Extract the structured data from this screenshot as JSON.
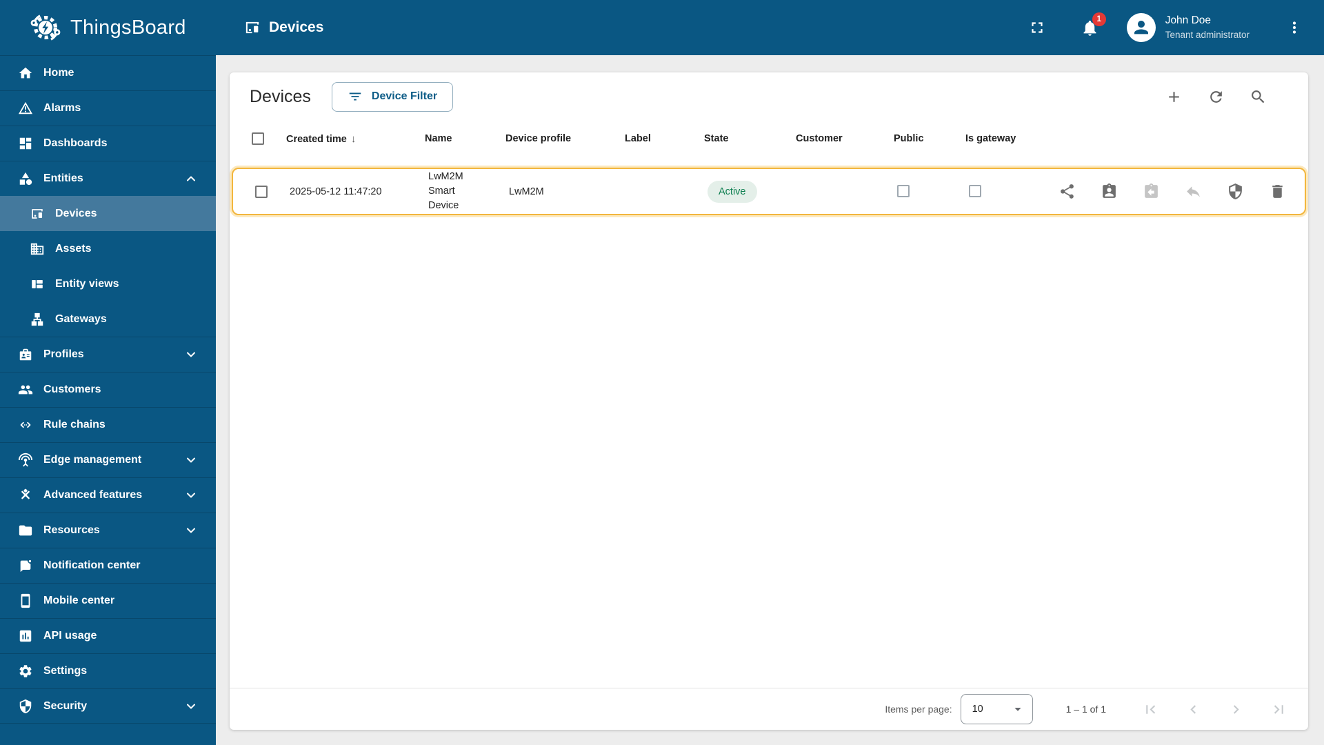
{
  "colors": {
    "primary": "#0a5783",
    "sidebar_selected": "#44799d",
    "row_highlight_border": "#f2b63d",
    "active_state_bg": "#e4efe9",
    "active_state_text": "#0c7e4f",
    "badge_red": "#e53935",
    "content_background": "#ededed"
  },
  "header": {
    "app_name": "ThingsBoard",
    "breadcrumb": "Devices",
    "notification_count": "1",
    "icons": [
      "thingsboard-logo-icon",
      "devices-breadcrumb-icon",
      "fullscreen-icon",
      "notifications-icon",
      "user-avatar-icon",
      "more-vert-icon"
    ],
    "user": {
      "name": "John Doe",
      "role": "Tenant administrator"
    }
  },
  "sidebar": {
    "items": [
      {
        "label": "Home",
        "icon": "home-icon"
      },
      {
        "label": "Alarms",
        "icon": "alarms-icon"
      },
      {
        "label": "Dashboards",
        "icon": "dashboards-icon"
      },
      {
        "label": "Entities",
        "icon": "entities-icon",
        "expandable": true,
        "expanded": true
      },
      {
        "label": "Devices",
        "icon": "devices-icon",
        "sub": true,
        "selected": true
      },
      {
        "label": "Assets",
        "icon": "assets-icon",
        "sub": true
      },
      {
        "label": "Entity views",
        "icon": "entity-views-icon",
        "sub": true
      },
      {
        "label": "Gateways",
        "icon": "gateways-icon",
        "sub": true
      },
      {
        "label": "Profiles",
        "icon": "profiles-icon",
        "expandable": true,
        "expanded": false
      },
      {
        "label": "Customers",
        "icon": "customers-icon"
      },
      {
        "label": "Rule chains",
        "icon": "rule-chains-icon"
      },
      {
        "label": "Edge management",
        "icon": "edge-management-icon",
        "expandable": true,
        "expanded": false
      },
      {
        "label": "Advanced features",
        "icon": "advanced-features-icon",
        "expandable": true,
        "expanded": false
      },
      {
        "label": "Resources",
        "icon": "resources-icon",
        "expandable": true,
        "expanded": false
      },
      {
        "label": "Notification center",
        "icon": "notification-center-icon"
      },
      {
        "label": "Mobile center",
        "icon": "mobile-center-icon"
      },
      {
        "label": "API usage",
        "icon": "api-usage-icon"
      },
      {
        "label": "Settings",
        "icon": "settings-icon"
      },
      {
        "label": "Security",
        "icon": "security-icon",
        "expandable": true,
        "expanded": false
      }
    ]
  },
  "main": {
    "title": "Devices",
    "filter_button": "Device Filter",
    "toolbar_icons": [
      "add-icon",
      "refresh-icon",
      "search-icon"
    ],
    "table": {
      "columns": [
        "Created time",
        "Name",
        "Device profile",
        "Label",
        "State",
        "Customer",
        "Public",
        "Is gateway"
      ],
      "sort": {
        "column": "Created time",
        "direction": "desc"
      },
      "rows": [
        {
          "created_time": "2025-05-12 11:47:20",
          "name": "LwM2M Smart Device",
          "name_lines": [
            "LwM2M",
            "Smart",
            "Device"
          ],
          "device_profile": "LwM2M",
          "label": "",
          "state": "Active",
          "customer": "",
          "public": false,
          "is_gateway": false,
          "highlighted": true,
          "actions": [
            {
              "icon": "share-icon",
              "enabled": true
            },
            {
              "icon": "assign-customer-icon",
              "enabled": true
            },
            {
              "icon": "make-public-icon",
              "enabled": false
            },
            {
              "icon": "unassign-icon",
              "enabled": false
            },
            {
              "icon": "manage-credentials-icon",
              "enabled": true
            },
            {
              "icon": "delete-icon",
              "enabled": true
            }
          ]
        }
      ]
    },
    "pagination": {
      "items_per_page_label": "Items per page:",
      "items_per_page": "10",
      "range_label": "1 – 1 of 1",
      "icons": [
        "first-page-icon",
        "previous-page-icon",
        "next-page-icon",
        "last-page-icon"
      ],
      "first_disabled": true,
      "prev_disabled": true,
      "next_disabled": true,
      "last_disabled": true
    }
  }
}
